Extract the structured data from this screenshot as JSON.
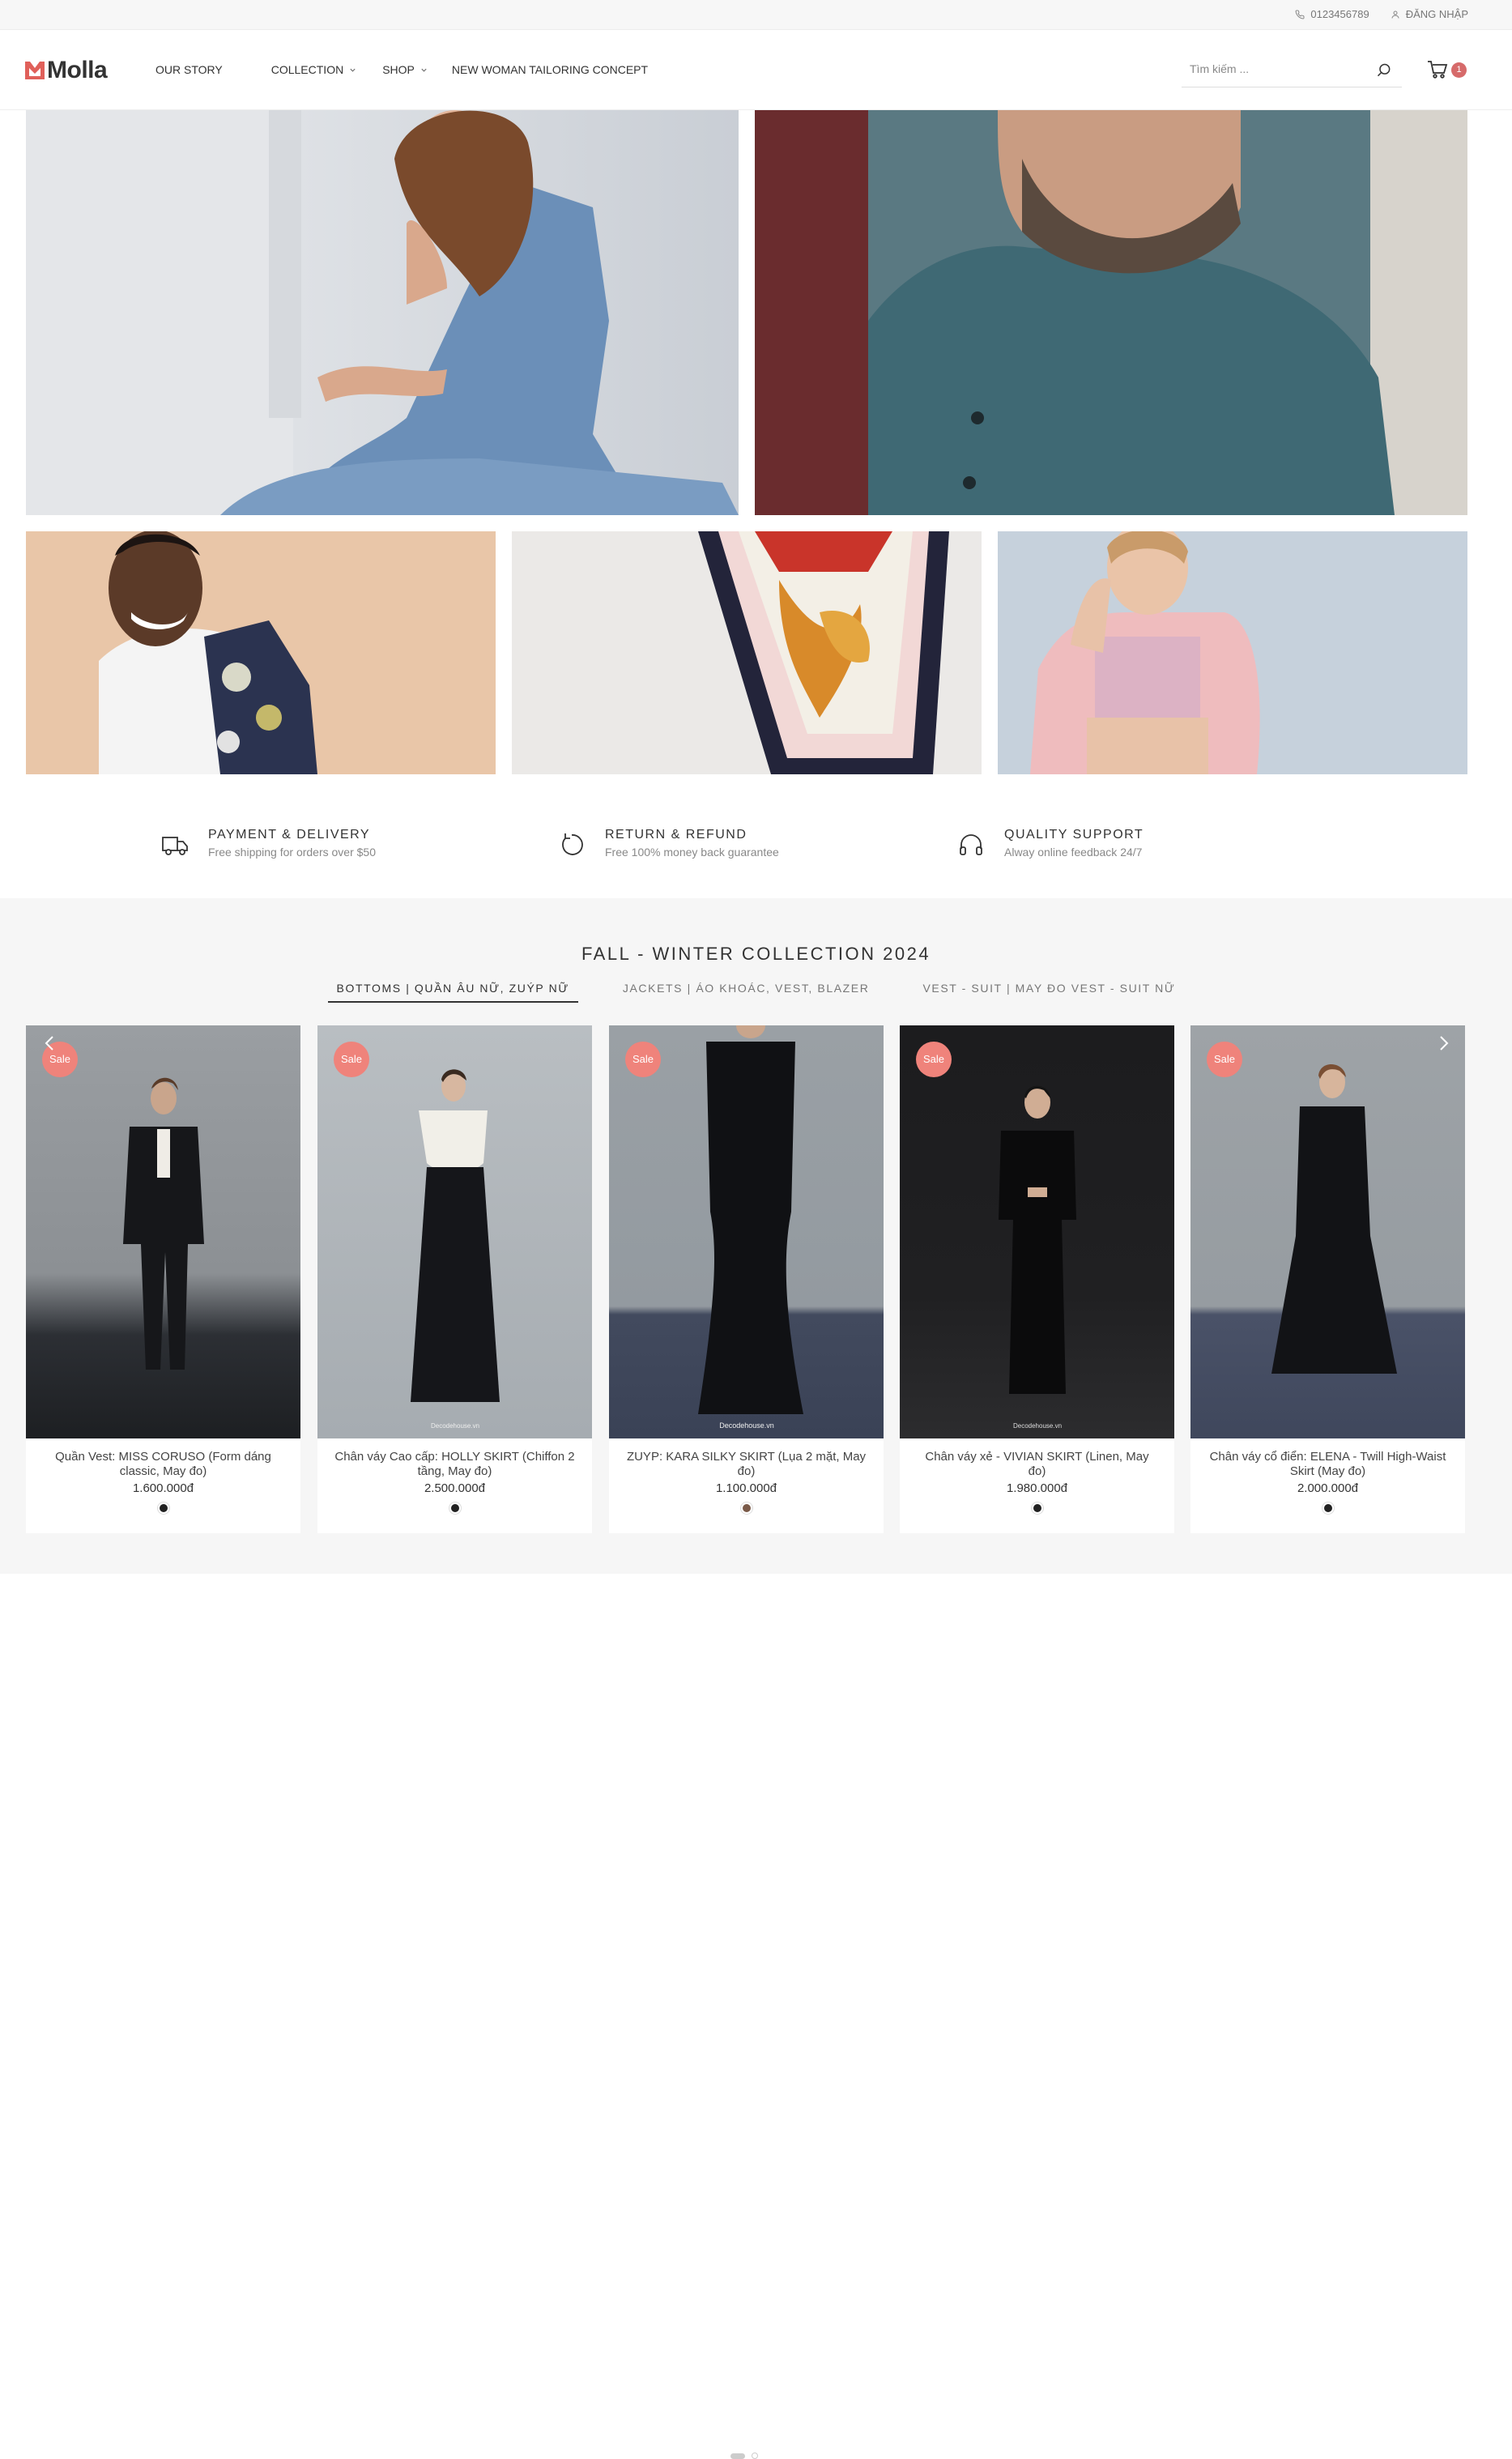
{
  "topbar": {
    "phone": "0123456789",
    "login": "ĐĂNG NHẬP"
  },
  "header": {
    "logo_text": "Molla",
    "nav": [
      {
        "label": "OUR STORY",
        "dropdown": false
      },
      {
        "label": "COLLECTION",
        "dropdown": true
      },
      {
        "label": "SHOP",
        "dropdown": true
      },
      {
        "label": "NEW WOMAN TAILORING CONCEPT",
        "dropdown": false
      }
    ],
    "search_placeholder": "Tìm kiếm ...",
    "cart_count": "1"
  },
  "banners": [
    {
      "name": "woman-denim-dress"
    },
    {
      "name": "man-teal-henley"
    },
    {
      "name": "man-floral-tee"
    },
    {
      "name": "silk-scarf"
    },
    {
      "name": "woman-pink-jacket"
    }
  ],
  "features": [
    {
      "title": "PAYMENT & DELIVERY",
      "subtitle": "Free shipping for orders over $50",
      "icon": "truck-icon"
    },
    {
      "title": "RETURN & REFUND",
      "subtitle": "Free 100% money back guarantee",
      "icon": "refund-icon"
    },
    {
      "title": "QUALITY SUPPORT",
      "subtitle": "Alway online feedback 24/7",
      "icon": "headphones-icon"
    }
  ],
  "collection": {
    "title": "FALL - WINTER COLLECTION 2024",
    "tabs": [
      {
        "label": "BOTTOMS | QUẦN ÂU NỮ, ZUÝP NỮ",
        "active": true
      },
      {
        "label": "JACKETS | ÁO KHOÁC, VEST, BLAZER",
        "active": false
      },
      {
        "label": "VEST - SUIT | MAY ĐO VEST - SUIT NỮ",
        "active": false
      }
    ],
    "sale_label": "Sale",
    "products": [
      {
        "name": "Quần Vest: MISS CORUSO (Form dáng classic, May đo)",
        "price": "1.600.000đ",
        "swatch": "#222222"
      },
      {
        "name": "Chân váy Cao cấp: HOLLY SKIRT (Chiffon 2 tầng, May đo)",
        "price": "2.500.000đ",
        "swatch": "#222222"
      },
      {
        "name": "ZUYP: KARA SILKY SKIRT (Lụa 2 mặt, May đo)",
        "price": "1.100.000đ",
        "swatch": "#7a5a48"
      },
      {
        "name": "Chân váy xẻ - VIVIAN SKIRT (Linen, May đo)",
        "price": "1.980.000đ",
        "swatch": "#222222"
      },
      {
        "name": "Chân váy cổ điển: ELENA - Twill High-Waist Skirt (May đo)",
        "price": "2.000.000đ",
        "swatch": "#222222"
      }
    ],
    "watermark": "Decodehouse.vn"
  },
  "colors": {
    "accent": "#d66a6a",
    "sale_badge": "#ef837b",
    "section_bg": "#f6f6f6"
  }
}
